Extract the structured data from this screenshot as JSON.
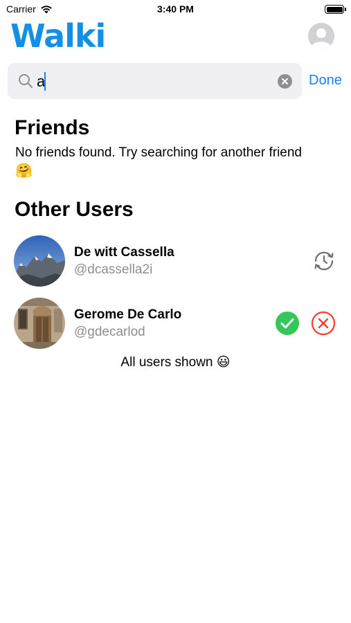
{
  "status_bar": {
    "carrier": "Carrier",
    "time": "3:40 PM"
  },
  "header": {
    "logo": "Walki",
    "profile_icon": "person-placeholder-icon"
  },
  "search": {
    "value": "a",
    "placeholder": "",
    "done_label": "Done"
  },
  "friends": {
    "title": "Friends",
    "empty_message": "No friends found. Try searching for another friend",
    "empty_emoji": "🤗"
  },
  "other_users": {
    "title": "Other Users",
    "users": [
      {
        "name": "De witt Cassella",
        "handle": "@dcassella2i",
        "action_icon": "pending-request-icon"
      },
      {
        "name": "Gerome De Carlo",
        "handle": "@gdecarlod",
        "action_icons": [
          "accept-check-icon",
          "reject-x-icon"
        ]
      }
    ],
    "footer": "All users shown 😃"
  },
  "colors": {
    "brand": "#1390e6",
    "link": "#1a7ff0",
    "accept": "#34c759",
    "reject": "#ff3b30",
    "secondary_text": "#8e8e93"
  }
}
